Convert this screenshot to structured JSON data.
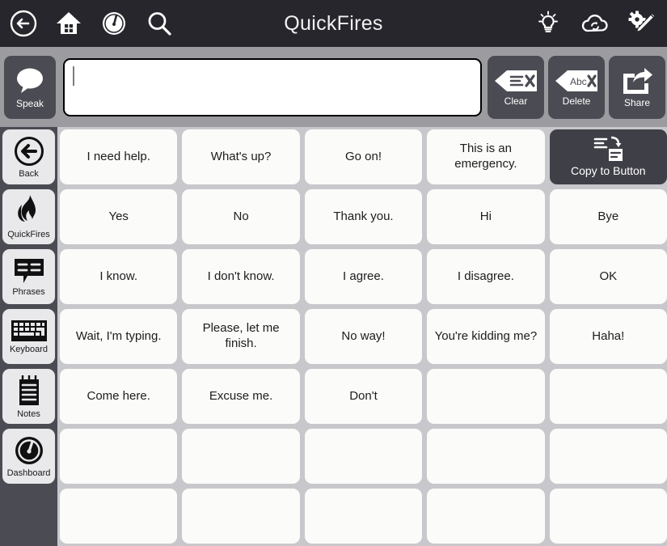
{
  "header": {
    "title": "QuickFires",
    "left_icons": [
      {
        "name": "back-arrow-icon",
        "label": "Back"
      },
      {
        "name": "home-icon",
        "label": "Home"
      },
      {
        "name": "dashboard-gauge-icon",
        "label": "Dashboard"
      },
      {
        "name": "search-icon",
        "label": "Search"
      }
    ],
    "right_icons": [
      {
        "name": "lightbulb-icon",
        "label": "Hints"
      },
      {
        "name": "cloud-sync-icon",
        "label": "Sync"
      },
      {
        "name": "edit-settings-icon",
        "label": "Edit"
      }
    ]
  },
  "toolbar": {
    "speak_label": "Speak",
    "message_value": "",
    "message_placeholder": "",
    "clear_label": "Clear",
    "delete_label": "Delete",
    "share_label": "Share",
    "delete_icon_text": "Abc"
  },
  "sidebar": {
    "items": [
      {
        "label": "Back",
        "icon": "back-arrow-icon"
      },
      {
        "label": "QuickFires",
        "icon": "flame-icon"
      },
      {
        "label": "Phrases",
        "icon": "speech-lines-icon"
      },
      {
        "label": "Keyboard",
        "icon": "keyboard-icon"
      },
      {
        "label": "Notes",
        "icon": "notepad-icon"
      },
      {
        "label": "Dashboard",
        "icon": "gauge-icon"
      }
    ]
  },
  "grid": {
    "columns": 5,
    "cells": [
      {
        "label": "I need help.",
        "type": "phrase"
      },
      {
        "label": "What's up?",
        "type": "phrase"
      },
      {
        "label": "Go on!",
        "type": "phrase"
      },
      {
        "label": "This is an emergency.",
        "type": "phrase"
      },
      {
        "label": "Copy to Button",
        "type": "action",
        "icon": "copy-to-button-icon"
      },
      {
        "label": "Yes",
        "type": "phrase"
      },
      {
        "label": "No",
        "type": "phrase"
      },
      {
        "label": "Thank you.",
        "type": "phrase"
      },
      {
        "label": "Hi",
        "type": "phrase"
      },
      {
        "label": "Bye",
        "type": "phrase"
      },
      {
        "label": "I know.",
        "type": "phrase"
      },
      {
        "label": "I don't know.",
        "type": "phrase"
      },
      {
        "label": "I agree.",
        "type": "phrase"
      },
      {
        "label": "I disagree.",
        "type": "phrase"
      },
      {
        "label": "OK",
        "type": "phrase"
      },
      {
        "label": "Wait, I'm typing.",
        "type": "phrase"
      },
      {
        "label": "Please, let me finish.",
        "type": "phrase"
      },
      {
        "label": "No way!",
        "type": "phrase"
      },
      {
        "label": "You're kidding me?",
        "type": "phrase"
      },
      {
        "label": "Haha!",
        "type": "phrase"
      },
      {
        "label": "Come here.",
        "type": "phrase"
      },
      {
        "label": "Excuse me.",
        "type": "phrase"
      },
      {
        "label": "Don't",
        "type": "phrase"
      },
      {
        "label": "",
        "type": "empty"
      },
      {
        "label": "",
        "type": "empty"
      },
      {
        "label": "",
        "type": "empty"
      },
      {
        "label": "",
        "type": "empty"
      },
      {
        "label": "",
        "type": "empty"
      },
      {
        "label": "",
        "type": "empty"
      },
      {
        "label": "",
        "type": "empty"
      },
      {
        "label": "",
        "type": "empty"
      },
      {
        "label": "",
        "type": "empty"
      },
      {
        "label": "",
        "type": "empty"
      },
      {
        "label": "",
        "type": "empty"
      },
      {
        "label": "",
        "type": "empty"
      }
    ]
  },
  "colors": {
    "header_bg": "#26262c",
    "toolbar_bg": "#9b9ba0",
    "panel_dark": "#4b4b53",
    "grid_bg": "#c8c8cc",
    "cell_bg": "#fbfbfa",
    "action_cell_bg": "#3f3f47",
    "sidebar_btn_bg": "#e9e9eb"
  }
}
